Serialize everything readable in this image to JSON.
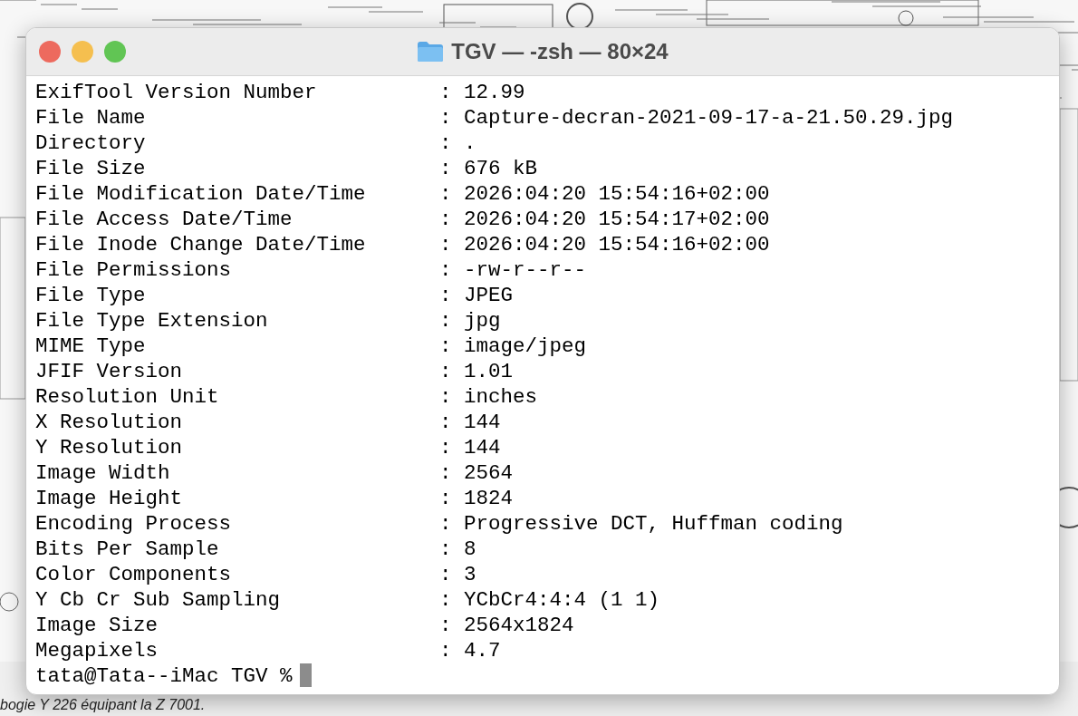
{
  "window": {
    "title": "TGV — -zsh — 80×24"
  },
  "separator": ":",
  "rows": [
    {
      "tag": "ExifTool Version Number",
      "value": "12.99"
    },
    {
      "tag": "File Name",
      "value": "Capture-decran-2021-09-17-a-21.50.29.jpg"
    },
    {
      "tag": "Directory",
      "value": "."
    },
    {
      "tag": "File Size",
      "value": "676 kB"
    },
    {
      "tag": "File Modification Date/Time",
      "value": "2026:04:20 15:54:16+02:00"
    },
    {
      "tag": "File Access Date/Time",
      "value": "2026:04:20 15:54:17+02:00"
    },
    {
      "tag": "File Inode Change Date/Time",
      "value": "2026:04:20 15:54:16+02:00"
    },
    {
      "tag": "File Permissions",
      "value": "-rw-r--r--"
    },
    {
      "tag": "File Type",
      "value": "JPEG"
    },
    {
      "tag": "File Type Extension",
      "value": "jpg"
    },
    {
      "tag": "MIME Type",
      "value": "image/jpeg"
    },
    {
      "tag": "JFIF Version",
      "value": "1.01"
    },
    {
      "tag": "Resolution Unit",
      "value": "inches"
    },
    {
      "tag": "X Resolution",
      "value": "144"
    },
    {
      "tag": "Y Resolution",
      "value": "144"
    },
    {
      "tag": "Image Width",
      "value": "2564"
    },
    {
      "tag": "Image Height",
      "value": "1824"
    },
    {
      "tag": "Encoding Process",
      "value": "Progressive DCT, Huffman coding"
    },
    {
      "tag": "Bits Per Sample",
      "value": "8"
    },
    {
      "tag": "Color Components",
      "value": "3"
    },
    {
      "tag": "Y Cb Cr Sub Sampling",
      "value": "YCbCr4:4:4 (1 1)"
    },
    {
      "tag": "Image Size",
      "value": "2564x1824"
    },
    {
      "tag": "Megapixels",
      "value": "4.7"
    }
  ],
  "prompt": "tata@Tata--iMac TGV %",
  "background_caption": "bogie Y 226 équipant la Z 7001."
}
